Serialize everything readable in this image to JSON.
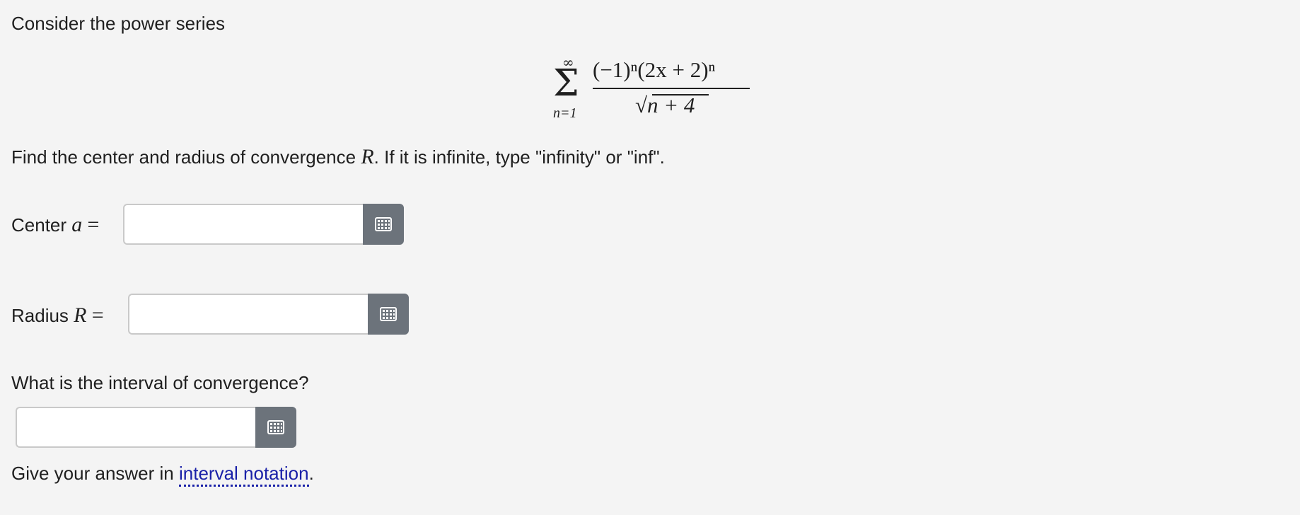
{
  "intro": "Consider the power series",
  "formula": {
    "sum_upper": "∞",
    "sum_lower": "n=1",
    "numerator": "(−1)ⁿ(2x + 2)ⁿ",
    "denominator": "n + 4"
  },
  "instruction": {
    "before": "Find the center and radius of convergence",
    "var": "R",
    "after": ". If it is infinite, type \"infinity\" or \"inf\"."
  },
  "center": {
    "label": "Center",
    "var": "a",
    "eq": "=",
    "value": ""
  },
  "radius": {
    "label": "Radius",
    "var": "R",
    "eq": "=",
    "value": ""
  },
  "interval_question": "What is the interval of convergence?",
  "interval": {
    "value": ""
  },
  "footer": {
    "before": "Give your answer in",
    "link": "interval notation",
    "after": "."
  },
  "icons": {
    "keyboard": "keyboard-grid-icon"
  },
  "colors": {
    "keyboard_button": "#6c737b",
    "link": "#1a21a8",
    "background": "#f4f4f4"
  }
}
